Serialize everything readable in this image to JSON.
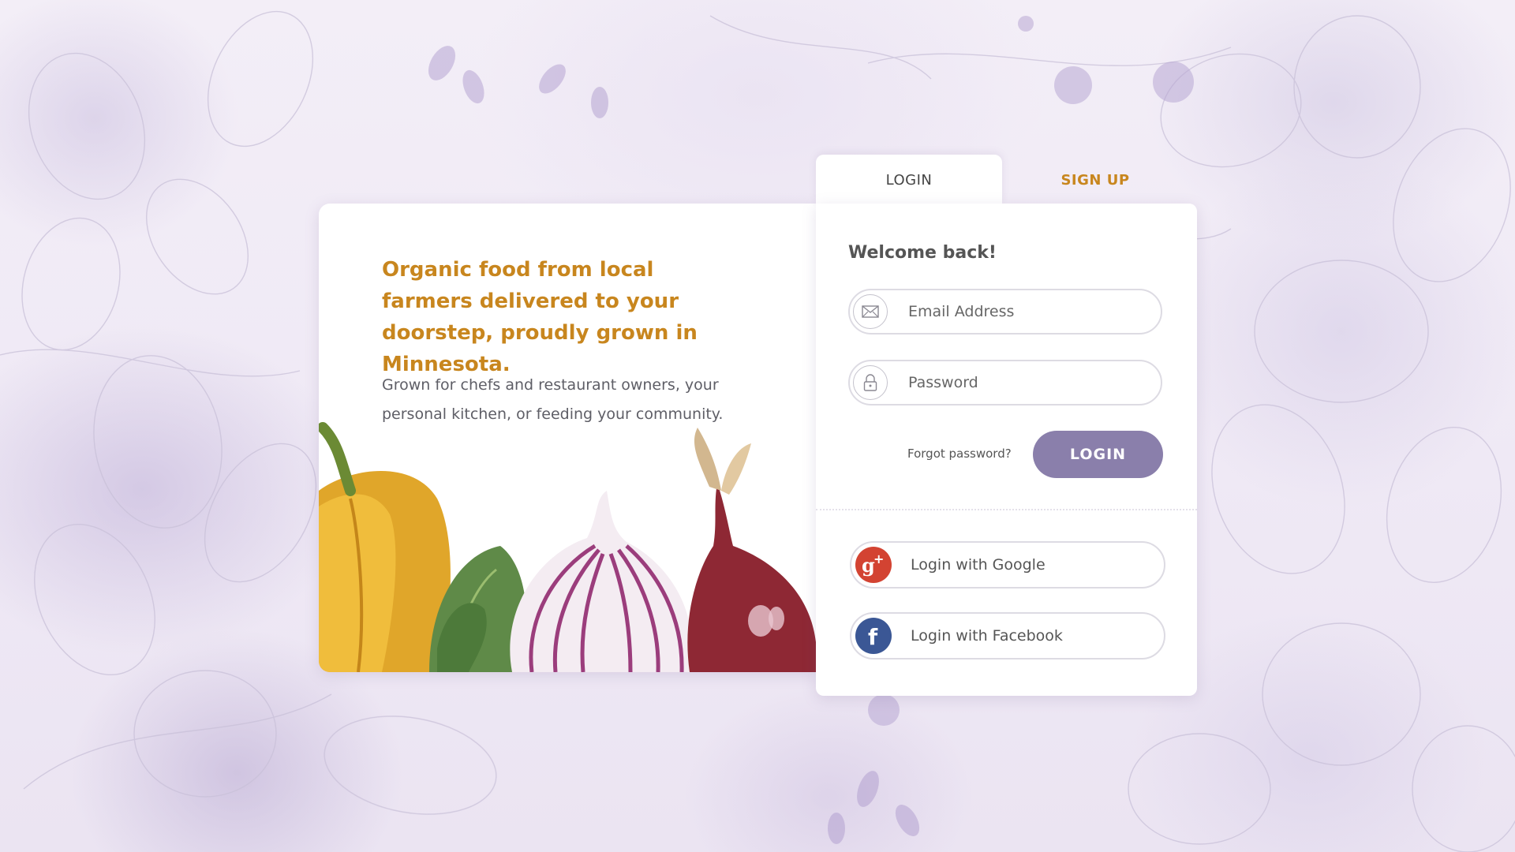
{
  "promo": {
    "headline": "Organic food from local farmers delivered to your doorstep, proudly grown in Minnesota.",
    "description": "Grown for chefs and restaurant owners, your personal kitchen, or feeding your community."
  },
  "tabs": {
    "login": "LOGIN",
    "signup": "SIGN UP"
  },
  "form": {
    "welcome": "Welcome back!",
    "email_placeholder": "Email Address",
    "password_placeholder": "Password",
    "forgot": "Forgot password?",
    "submit": "LOGIN"
  },
  "social": {
    "google": "Login with Google",
    "facebook": "Login with Facebook"
  },
  "colors": {
    "accent": "#c8861e",
    "button": "#8a7fab",
    "google": "#d34332",
    "facebook": "#3b5795"
  },
  "icons": {
    "email": "envelope-icon",
    "password": "lock-icon",
    "google": "google-plus-icon",
    "facebook": "facebook-icon"
  }
}
